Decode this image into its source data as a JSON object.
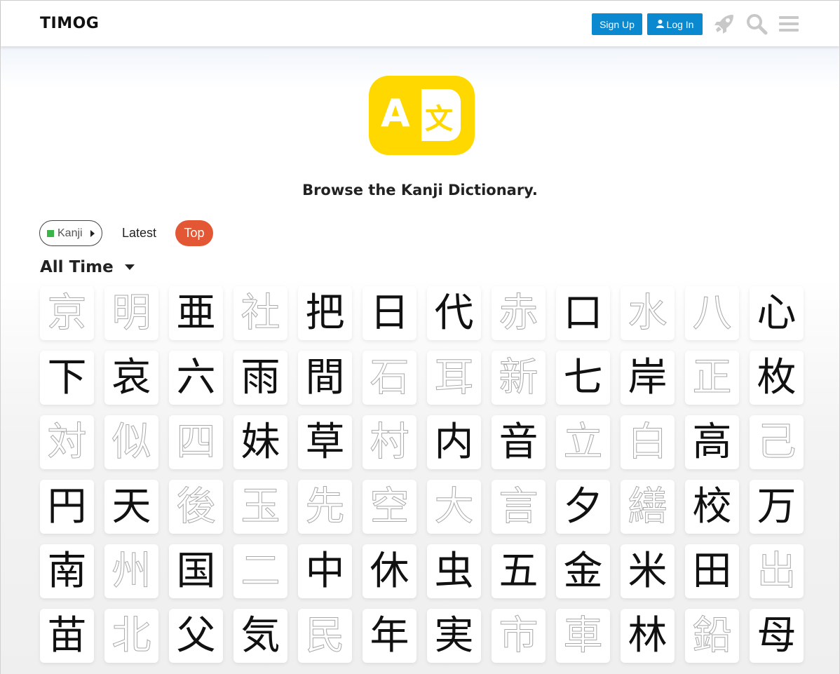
{
  "header": {
    "logo": "TIMOG",
    "signup_label": "Sign Up",
    "login_label": "Log In",
    "icons": [
      "rocket-icon",
      "search-icon",
      "menu-icon"
    ]
  },
  "colors": {
    "primary_button": "#0a88d0",
    "top_pill": "#e45735",
    "category_square": "#3ab54a",
    "hero_logo": "#ffd800",
    "stroke_highlight": "#e00000"
  },
  "hero": {
    "logo_letter": "A",
    "logo_glyph": "文",
    "title": "Browse the Kanji Dictionary."
  },
  "nav": {
    "category_label": "Kanji",
    "latest_label": "Latest",
    "top_label": "Top"
  },
  "period": {
    "label": "All Time"
  },
  "kanji_rows": [
    [
      {
        "char": "京",
        "state": "faded"
      },
      {
        "char": "明",
        "state": "faded"
      },
      {
        "char": "亜",
        "state": "done"
      },
      {
        "char": "社",
        "state": "faded"
      },
      {
        "char": "把",
        "state": "done"
      },
      {
        "char": "日",
        "state": "done"
      },
      {
        "char": "代",
        "state": "done"
      },
      {
        "char": "赤",
        "state": "faded"
      },
      {
        "char": "口",
        "state": "done"
      },
      {
        "char": "水",
        "state": "faded"
      },
      {
        "char": "八",
        "state": "faded"
      },
      {
        "char": "心",
        "state": "done"
      }
    ],
    [
      {
        "char": "下",
        "state": "done"
      },
      {
        "char": "哀",
        "state": "done"
      },
      {
        "char": "六",
        "state": "done"
      },
      {
        "char": "雨",
        "state": "done"
      },
      {
        "char": "間",
        "state": "done"
      },
      {
        "char": "石",
        "state": "faded"
      },
      {
        "char": "耳",
        "state": "faded"
      },
      {
        "char": "新",
        "state": "faded"
      },
      {
        "char": "七",
        "state": "done"
      },
      {
        "char": "岸",
        "state": "done"
      },
      {
        "char": "正",
        "state": "faded"
      },
      {
        "char": "枚",
        "state": "done"
      }
    ],
    [
      {
        "char": "対",
        "state": "faded"
      },
      {
        "char": "似",
        "state": "faded"
      },
      {
        "char": "四",
        "state": "faded"
      },
      {
        "char": "妹",
        "state": "done"
      },
      {
        "char": "草",
        "state": "done"
      },
      {
        "char": "村",
        "state": "faded"
      },
      {
        "char": "内",
        "state": "done"
      },
      {
        "char": "音",
        "state": "done"
      },
      {
        "char": "立",
        "state": "faded"
      },
      {
        "char": "白",
        "state": "faded"
      },
      {
        "char": "高",
        "state": "done"
      },
      {
        "char": "己",
        "state": "faded"
      }
    ],
    [
      {
        "char": "円",
        "state": "done"
      },
      {
        "char": "天",
        "state": "done"
      },
      {
        "char": "後",
        "state": "faded"
      },
      {
        "char": "玉",
        "state": "faded"
      },
      {
        "char": "先",
        "state": "faded"
      },
      {
        "char": "空",
        "state": "faded"
      },
      {
        "char": "大",
        "state": "faded"
      },
      {
        "char": "言",
        "state": "faded"
      },
      {
        "char": "夕",
        "state": "done"
      },
      {
        "char": "繕",
        "state": "faded"
      },
      {
        "char": "校",
        "state": "done"
      },
      {
        "char": "万",
        "state": "done"
      }
    ],
    [
      {
        "char": "南",
        "state": "done"
      },
      {
        "char": "州",
        "state": "faded"
      },
      {
        "char": "国",
        "state": "done"
      },
      {
        "char": "二",
        "state": "faded"
      },
      {
        "char": "中",
        "state": "done"
      },
      {
        "char": "休",
        "state": "done"
      },
      {
        "char": "虫",
        "state": "done"
      },
      {
        "char": "五",
        "state": "done"
      },
      {
        "char": "金",
        "state": "done"
      },
      {
        "char": "米",
        "state": "done"
      },
      {
        "char": "田",
        "state": "done"
      },
      {
        "char": "出",
        "state": "faded"
      }
    ],
    [
      {
        "char": "苗",
        "state": "done"
      },
      {
        "char": "北",
        "state": "faded"
      },
      {
        "char": "父",
        "state": "done"
      },
      {
        "char": "気",
        "state": "done"
      },
      {
        "char": "民",
        "state": "faded"
      },
      {
        "char": "年",
        "state": "done"
      },
      {
        "char": "実",
        "state": "done"
      },
      {
        "char": "市",
        "state": "faded"
      },
      {
        "char": "車",
        "state": "faded"
      },
      {
        "char": "林",
        "state": "done"
      },
      {
        "char": "鉛",
        "state": "faded"
      },
      {
        "char": "母",
        "state": "done"
      }
    ]
  ]
}
